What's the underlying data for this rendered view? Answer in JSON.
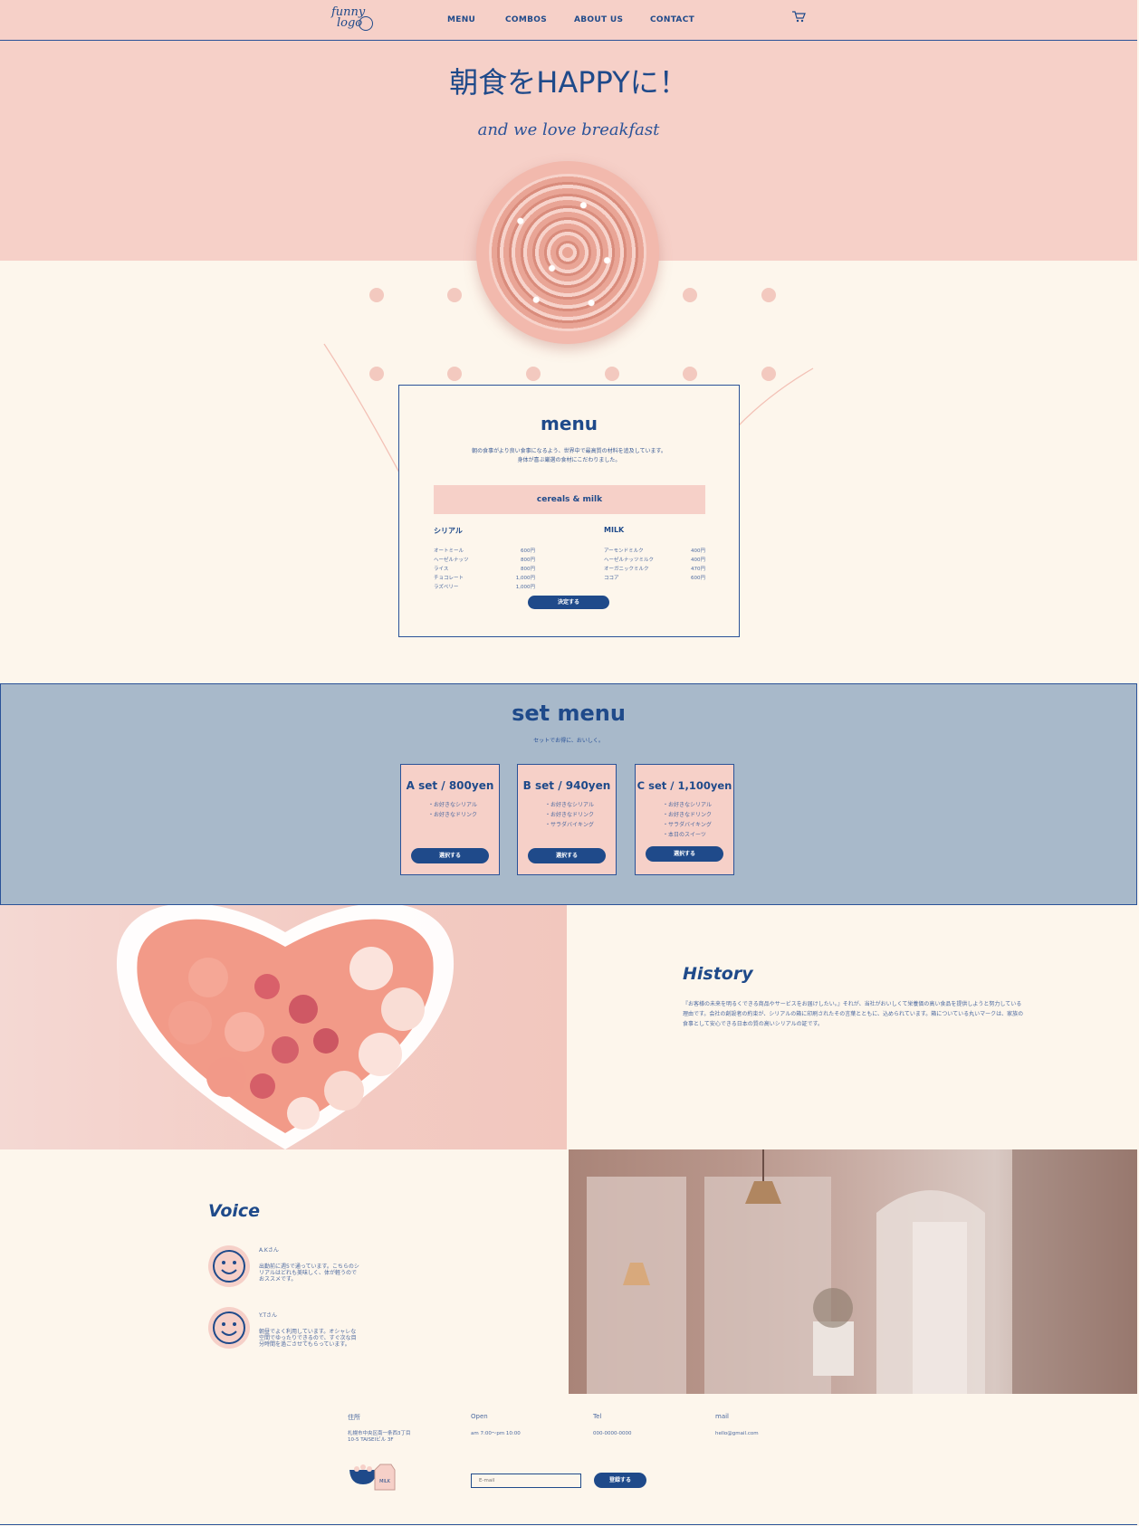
{
  "nav": {
    "logo_line1": "funny",
    "logo_line2": "logo",
    "links": [
      "MENU",
      "COMBOS",
      "ABOUT US",
      "CONTACT"
    ],
    "cart_icon": "cart-icon"
  },
  "hero": {
    "title": "朝食をHAPPYに！",
    "subtitle": "and we love breakfast"
  },
  "menu": {
    "title": "menu",
    "desc_line1": "朝の食事がより良い食事になるよう、世界中で最高質の材料を追及しています。",
    "desc_line2": "身体が喜ぶ厳選の食材にこだわりました。",
    "band": "cereals & milk",
    "cereal_head": "シリアル",
    "milk_head": "MILK",
    "cereal_items": [
      {
        "name": "オートミール",
        "price": "600円"
      },
      {
        "name": "ヘーゼルナッツ",
        "price": "800円"
      },
      {
        "name": "ライス",
        "price": "800円"
      },
      {
        "name": "チョコレート",
        "price": "1,000円"
      },
      {
        "name": "ラズベリー",
        "price": "1,000円"
      }
    ],
    "milk_items": [
      {
        "name": "アーモンドミルク",
        "price": "400円"
      },
      {
        "name": "ヘーゼルナッツミルク",
        "price": "400円"
      },
      {
        "name": "オーガニックミルク",
        "price": "470円"
      },
      {
        "name": "ココア",
        "price": "600円"
      }
    ],
    "button": "決定する"
  },
  "set_menu": {
    "title": "set menu",
    "subtitle": "セットでお得に、おいしく。",
    "sets": [
      {
        "title": "A set / 800yen",
        "items": [
          "・お好きなシリアル",
          "・お好きなドリンク"
        ],
        "button": "選択する"
      },
      {
        "title": "B set / 940yen",
        "items": [
          "・お好きなシリアル",
          "・お好きなドリンク",
          "・サラダバイキング"
        ],
        "button": "選択する"
      },
      {
        "title": "C set / 1,100yen",
        "items": [
          "・お好きなシリアル",
          "・お好きなドリンク",
          "・サラダバイキング",
          "・本日のスイーツ"
        ],
        "button": "選択する"
      }
    ]
  },
  "history": {
    "title": "History",
    "text": "『お客様の未来を明るくできる商品やサービスをお届けしたい。』それが、当社がおいしくて栄養価の高い食品を提供しようと努力している理由です。会社の創設者の約束が、シリアルの箱に印刷されたその言葉とともに、込められています。箱についている丸いマークは、家族の食事として安心できる日本の質の高いシリアルの証です。"
  },
  "voice": {
    "title": "Voice",
    "entries": [
      {
        "name": "A.Kさん",
        "text": "出勤前に週5で通っています。こちらのシリアルはどれも美味しく、体が軽うのでおススメです。"
      },
      {
        "name": "Y.Tさん",
        "text": "朝昼でよく利用しています。オシャレな空間でゆったりできるので、すぐ次な目分時間を過ごさせてもらっています。"
      }
    ]
  },
  "footer": {
    "address_label": "住所",
    "address_value": "札幌市中央区南一条西3丁目 10-5 TAISEIビル 3F",
    "open_label": "Open",
    "open_value": "am 7:00～pm 10:00",
    "tel_label": "Tel",
    "tel_value": "000-0000-0000",
    "mail_label": "mail",
    "mail_value": "hello@gmail.com",
    "email_placeholder": "E-mail",
    "register_button": "登録する",
    "milk_carton_text": "MILK"
  },
  "colors": {
    "pink": "#f6d0c8",
    "navy": "#1f4a8a",
    "cream": "#fdf6ec",
    "blue_gray": "#a8b9ca"
  }
}
